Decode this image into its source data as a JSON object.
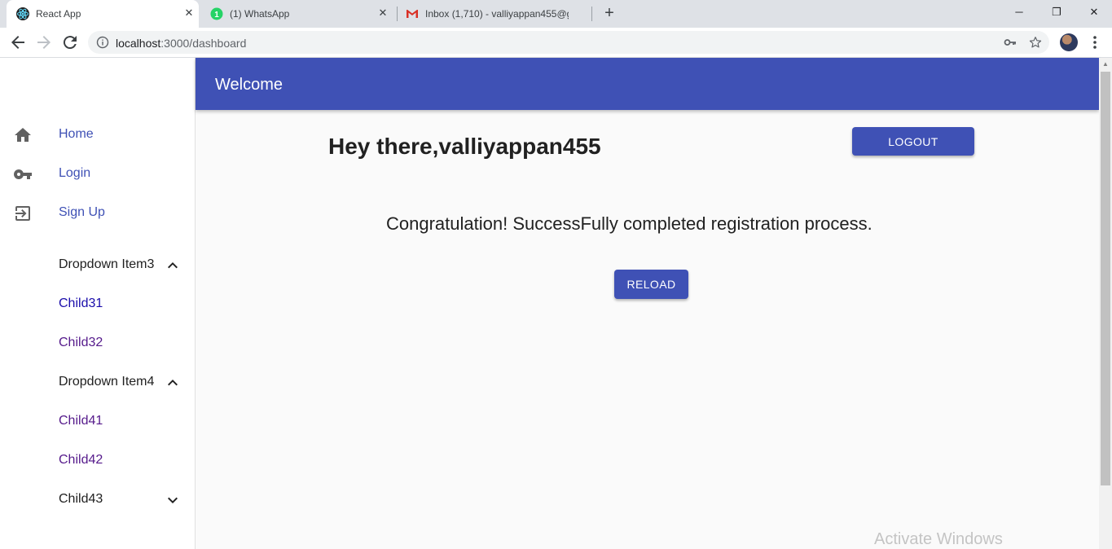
{
  "browser": {
    "tabs": [
      {
        "title": "React App",
        "icon": "react-icon",
        "active": true
      },
      {
        "title": "(1) WhatsApp",
        "icon": "whatsapp-icon",
        "badge": "1",
        "active": false
      },
      {
        "title": "Inbox (1,710) - valliyappan455@g",
        "icon": "gmail-icon",
        "active": false
      }
    ],
    "new_tab_label": "+",
    "close_glyph": "✕",
    "url_host": "localhost",
    "url_path": ":3000/dashboard",
    "window_controls": {
      "minimize": "─",
      "restore": "❐",
      "close": "✕"
    }
  },
  "appbar": {
    "title": "Welcome",
    "color": "#3f51b5"
  },
  "sidebar": {
    "items": [
      {
        "label": "Home",
        "icon": "home-icon"
      },
      {
        "label": "Login",
        "icon": "key-icon"
      },
      {
        "label": "Sign Up",
        "icon": "signup-icon"
      }
    ],
    "dropdowns": [
      {
        "label": "Dropdown Item3",
        "expanded": true,
        "children": [
          "Child31",
          "Child32"
        ]
      },
      {
        "label": "Dropdown Item4",
        "expanded": true,
        "children": [
          "Child41",
          "Child42"
        ]
      },
      {
        "label": "Child43",
        "expanded": false,
        "children": []
      }
    ]
  },
  "main": {
    "greeting": "Hey there,valliyappan455",
    "logout_label": "LOGOUT",
    "message": "Congratulation! SuccessFully completed registration process.",
    "reload_label": "RELOAD"
  },
  "watermark": "Activate Windows"
}
